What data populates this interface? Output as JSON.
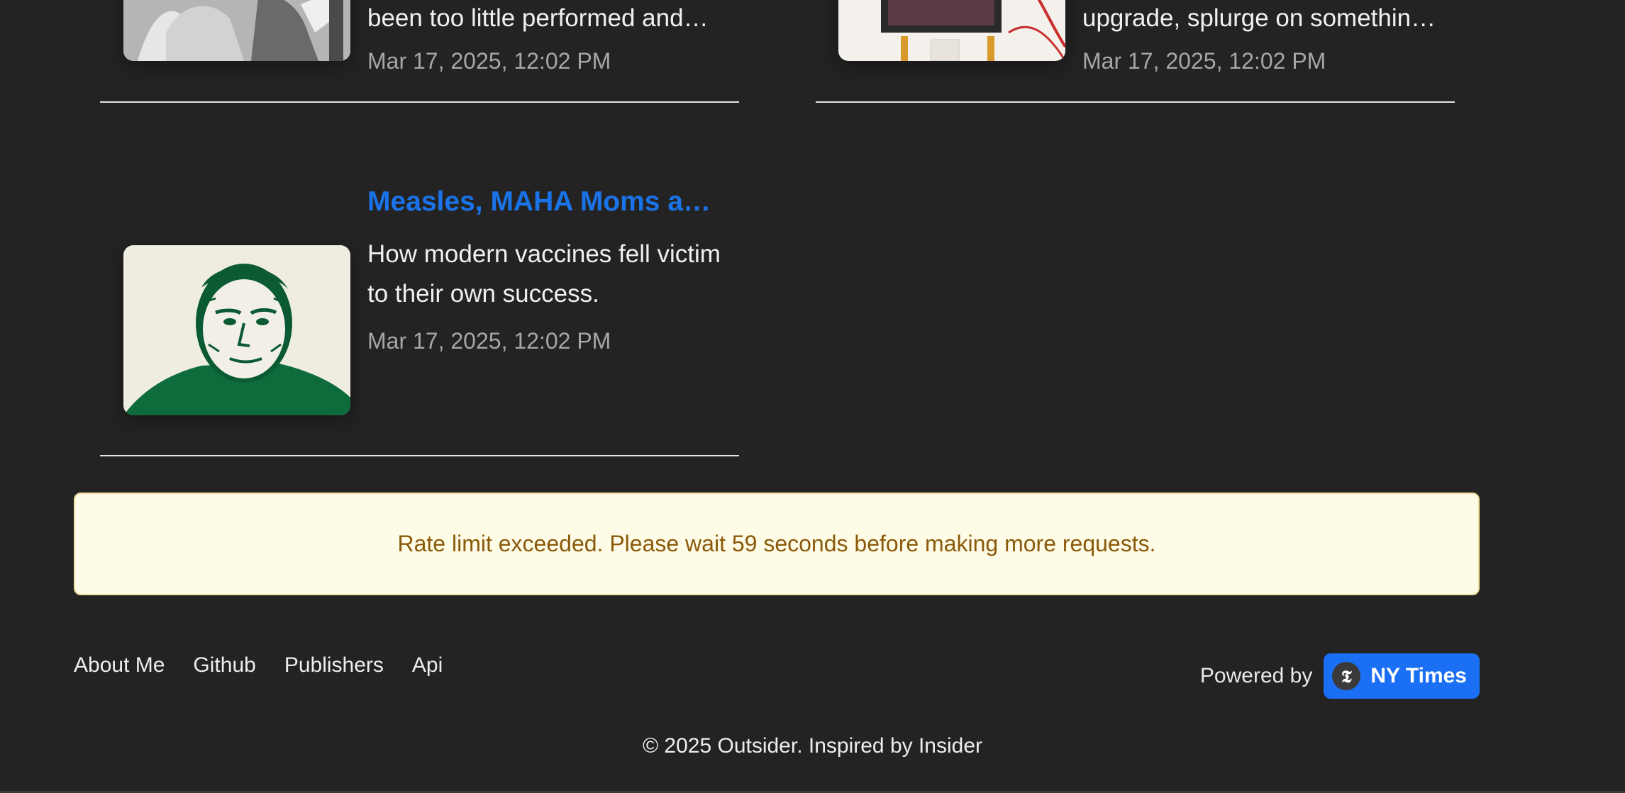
{
  "articles": [
    {
      "summary": "been too little performed and…",
      "date": "Mar 17, 2025, 12:02 PM",
      "image": "theater-performers-photo"
    },
    {
      "summary": "upgrade, splurge on somethin…",
      "date": "Mar 17, 2025, 12:02 PM",
      "image": "candles-home-decor-photo"
    },
    {
      "title": "Measles, MAHA Moms an…",
      "summary": "How modern vaccines fell victim to their own success.",
      "date": "Mar 17, 2025, 12:02 PM",
      "image": "older-man-portrait-green"
    }
  ],
  "alert": {
    "message": "Rate limit exceeded. Please wait 59 seconds before making more requests."
  },
  "footer": {
    "links": [
      "About Me",
      "Github",
      "Publishers",
      "Api"
    ],
    "powered_by": "Powered by",
    "badge_label": "NY Times",
    "badge_icon": "nyt-logo-icon",
    "copyright": "© 2025 Outsider. Inspired by Insider"
  },
  "colors": {
    "background": "#232323",
    "title_link": "#1a73e8",
    "alert_bg": "#fefbe7",
    "alert_text": "#8a5a0a",
    "badge_bg": "#1a6ff5"
  }
}
